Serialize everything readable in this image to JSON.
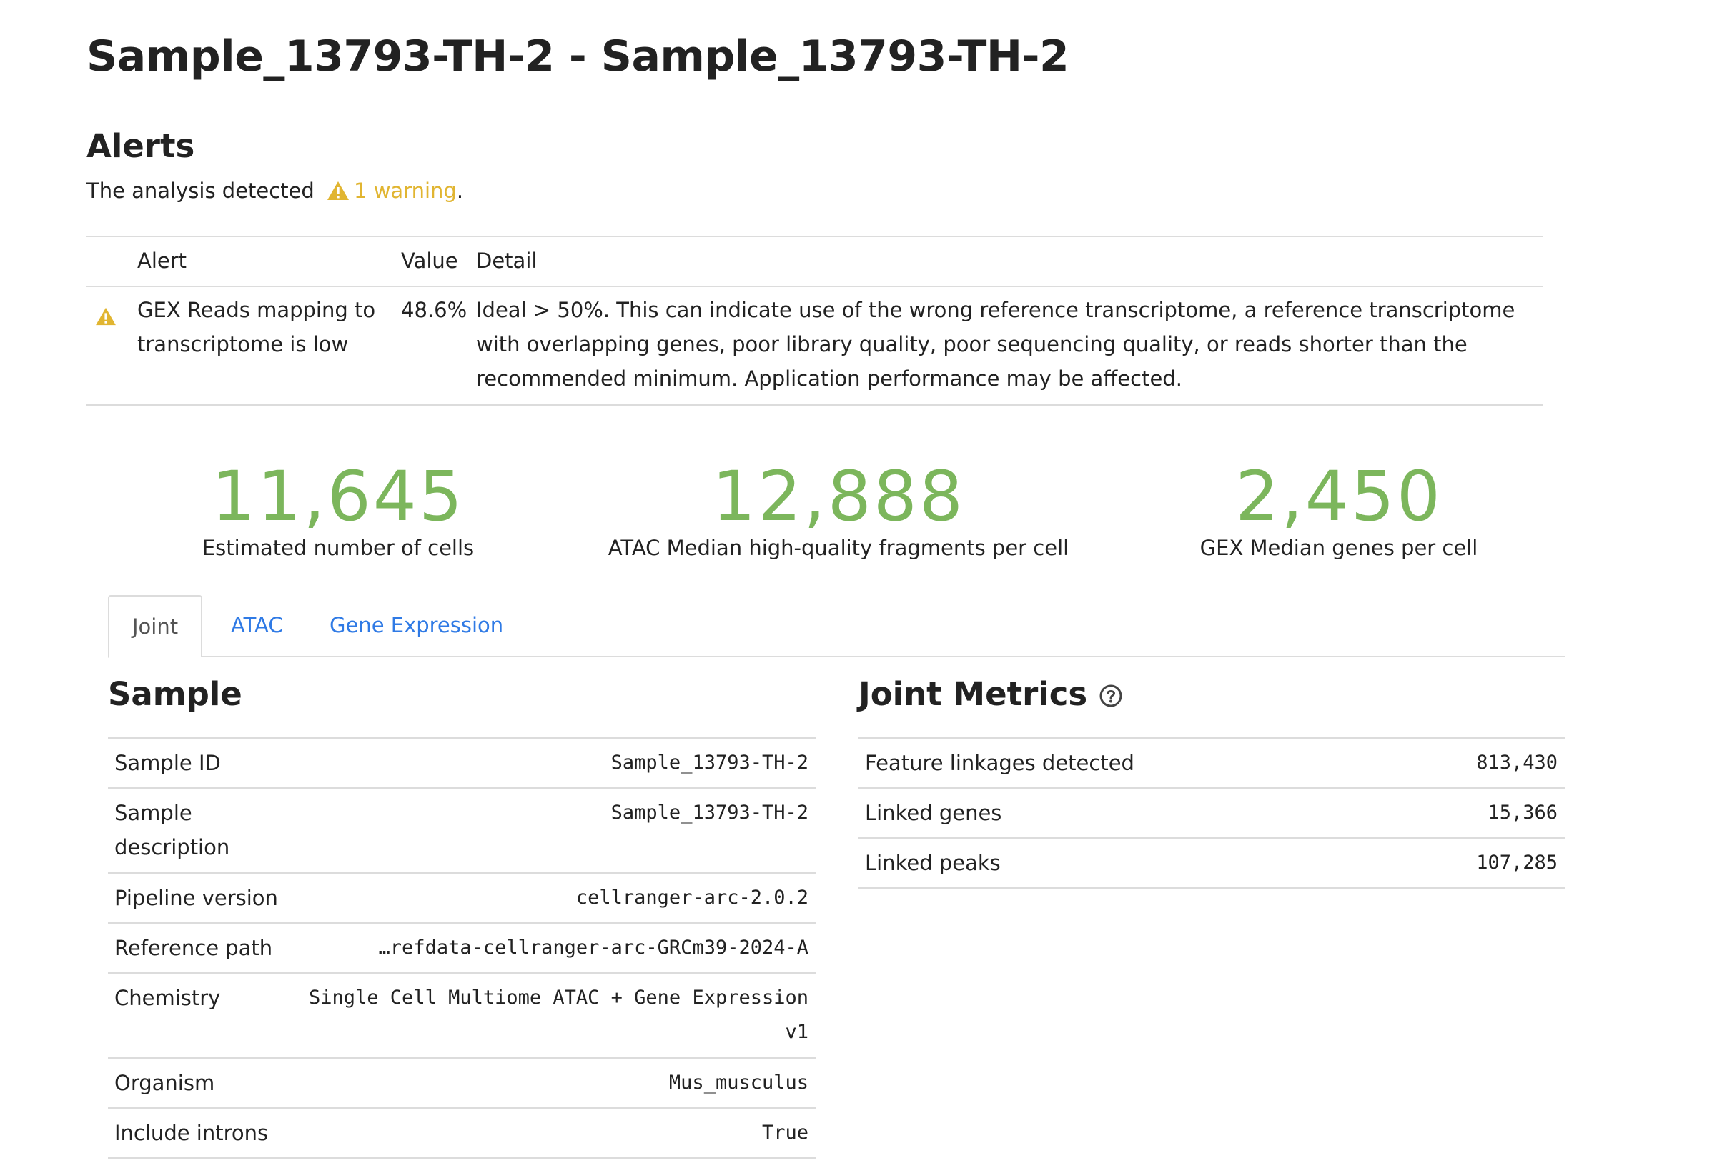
{
  "page": {
    "title": "Sample_13793-TH-2 - Sample_13793-TH-2"
  },
  "alerts": {
    "heading": "Alerts",
    "summary_prefix": "The analysis detected",
    "warning_link": "1 warning",
    "summary_suffix": ".",
    "columns": {
      "alert": "Alert",
      "value": "Value",
      "detail": "Detail"
    },
    "rows": [
      {
        "icon": "warning-icon",
        "alert": "GEX Reads mapping to transcriptome is low",
        "value": "48.6%",
        "detail": "Ideal > 50%. This can indicate use of the wrong reference transcriptome, a reference transcriptome with overlapping genes, poor library quality, poor sequencing quality, or reads shorter than the recommended minimum. Application performance may be affected."
      }
    ]
  },
  "headline_metrics": [
    {
      "value": "11,645",
      "label": "Estimated number of cells"
    },
    {
      "value": "12,888",
      "label": "ATAC Median high-quality fragments per cell"
    },
    {
      "value": "2,450",
      "label": "GEX Median genes per cell"
    }
  ],
  "tabs": [
    {
      "label": "Joint",
      "active": true
    },
    {
      "label": "ATAC",
      "active": false
    },
    {
      "label": "Gene Expression",
      "active": false
    }
  ],
  "sample": {
    "heading": "Sample",
    "rows": [
      {
        "key": "Sample ID",
        "value": "Sample_13793-TH-2"
      },
      {
        "key": "Sample description",
        "value": "Sample_13793-TH-2"
      },
      {
        "key": "Pipeline version",
        "value": "cellranger-arc-2.0.2"
      },
      {
        "key": "Reference path",
        "value": "…refdata-cellranger-arc-GRCm39-2024-A"
      },
      {
        "key": "Chemistry",
        "value": "Single Cell Multiome ATAC + Gene Expression v1"
      },
      {
        "key": "Organism",
        "value": "Mus_musculus"
      },
      {
        "key": "Include introns",
        "value": "True"
      }
    ]
  },
  "joint_metrics": {
    "heading": "Joint Metrics",
    "help_icon": "question-circle-icon",
    "rows": [
      {
        "key": "Feature linkages detected",
        "value": "813,430"
      },
      {
        "key": "Linked genes",
        "value": "15,366"
      },
      {
        "key": "Linked peaks",
        "value": "107,285"
      }
    ]
  },
  "colors": {
    "metric_green": "#7cb65c",
    "warning_yellow": "#e1b531",
    "link_blue": "#2f7ae5",
    "divider": "#dcdcdc"
  }
}
